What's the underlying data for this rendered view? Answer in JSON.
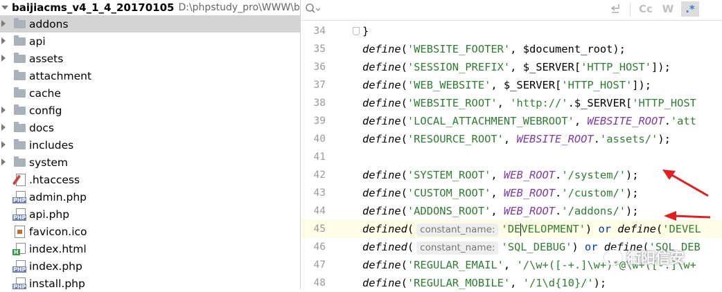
{
  "project": {
    "root_name": "baijiacms_v4_1_4_20170105",
    "root_path": "D:\\phpstudy_pro\\WWW\\ba"
  },
  "tree": [
    {
      "label": "addons",
      "type": "folder",
      "expandable": true,
      "selected": true
    },
    {
      "label": "api",
      "type": "folder",
      "expandable": true
    },
    {
      "label": "assets",
      "type": "folder",
      "expandable": true
    },
    {
      "label": "attachment",
      "type": "folder",
      "expandable": false
    },
    {
      "label": "cache",
      "type": "folder",
      "expandable": false
    },
    {
      "label": "config",
      "type": "folder",
      "expandable": true
    },
    {
      "label": "docs",
      "type": "folder",
      "expandable": true
    },
    {
      "label": "includes",
      "type": "folder",
      "expandable": true
    },
    {
      "label": "system",
      "type": "folder",
      "expandable": true
    },
    {
      "label": ".htaccess",
      "type": "htaccess"
    },
    {
      "label": "admin.php",
      "type": "php"
    },
    {
      "label": "api.php",
      "type": "php"
    },
    {
      "label": "favicon.ico",
      "type": "ico"
    },
    {
      "label": "index.html",
      "type": "html"
    },
    {
      "label": "index.php",
      "type": "php"
    },
    {
      "label": "install.php",
      "type": "php"
    }
  ],
  "icons": {
    "php_tag": "PHP",
    "html_tag": "H"
  },
  "search_bar": {
    "case_toggle": "Cc",
    "word_toggle": "W",
    "regex_toggle": ".*"
  },
  "code_lines": [
    {
      "num": "34",
      "segments": [
        {
          "t": "}",
          "c": ""
        }
      ]
    },
    {
      "num": "35",
      "segments": [
        {
          "t": "define",
          "c": "fn"
        },
        {
          "t": "(",
          "c": ""
        },
        {
          "t": "'WEBSITE_FOOTER'",
          "c": "str"
        },
        {
          "t": ", $document_root);",
          "c": "var"
        }
      ]
    },
    {
      "num": "36",
      "segments": [
        {
          "t": "define",
          "c": "fn"
        },
        {
          "t": "(",
          "c": ""
        },
        {
          "t": "'SESSION_PREFIX'",
          "c": "str"
        },
        {
          "t": ", $_SERVER[",
          "c": "var"
        },
        {
          "t": "'HTTP_HOST'",
          "c": "str"
        },
        {
          "t": "]);",
          "c": ""
        }
      ]
    },
    {
      "num": "37",
      "segments": [
        {
          "t": "define",
          "c": "fn"
        },
        {
          "t": "(",
          "c": ""
        },
        {
          "t": "'WEB_WEBSITE'",
          "c": "str"
        },
        {
          "t": ", $_SERVER[",
          "c": "var"
        },
        {
          "t": "'HTTP_HOST'",
          "c": "str"
        },
        {
          "t": "]);",
          "c": ""
        }
      ]
    },
    {
      "num": "38",
      "segments": [
        {
          "t": "define",
          "c": "fn"
        },
        {
          "t": "(",
          "c": ""
        },
        {
          "t": "'WEBSITE_ROOT'",
          "c": "str"
        },
        {
          "t": ", ",
          "c": ""
        },
        {
          "t": "'http://'",
          "c": "str"
        },
        {
          "t": ".$_SERVER[",
          "c": "var"
        },
        {
          "t": "'HTTP_HOST",
          "c": "str"
        }
      ]
    },
    {
      "num": "39",
      "segments": [
        {
          "t": "define",
          "c": "fn"
        },
        {
          "t": "(",
          "c": ""
        },
        {
          "t": "'LOCAL_ATTACHMENT_WEBROOT'",
          "c": "str"
        },
        {
          "t": ", ",
          "c": ""
        },
        {
          "t": "WEBSITE_ROOT",
          "c": "const"
        },
        {
          "t": ".",
          "c": ""
        },
        {
          "t": "'att",
          "c": "str"
        }
      ]
    },
    {
      "num": "40",
      "segments": [
        {
          "t": "define",
          "c": "fn"
        },
        {
          "t": "(",
          "c": ""
        },
        {
          "t": "'RESOURCE_ROOT'",
          "c": "str"
        },
        {
          "t": ", ",
          "c": ""
        },
        {
          "t": "WEBSITE_ROOT",
          "c": "const"
        },
        {
          "t": ".",
          "c": ""
        },
        {
          "t": "'assets/'",
          "c": "str"
        },
        {
          "t": ");",
          "c": ""
        }
      ]
    },
    {
      "num": "41",
      "segments": []
    },
    {
      "num": "42",
      "segments": [
        {
          "t": "define",
          "c": "fn"
        },
        {
          "t": "(",
          "c": ""
        },
        {
          "t": "'SYSTEM_ROOT'",
          "c": "str"
        },
        {
          "t": ", ",
          "c": ""
        },
        {
          "t": "WEB_ROOT",
          "c": "const"
        },
        {
          "t": ".",
          "c": ""
        },
        {
          "t": "'/system/'",
          "c": "str"
        },
        {
          "t": ");",
          "c": ""
        }
      ]
    },
    {
      "num": "43",
      "segments": [
        {
          "t": "define",
          "c": "fn"
        },
        {
          "t": "(",
          "c": ""
        },
        {
          "t": "'CUSTOM_ROOT'",
          "c": "str"
        },
        {
          "t": ", ",
          "c": ""
        },
        {
          "t": "WEB_ROOT",
          "c": "const"
        },
        {
          "t": ".",
          "c": ""
        },
        {
          "t": "'/custom/'",
          "c": "str"
        },
        {
          "t": ");",
          "c": ""
        }
      ]
    },
    {
      "num": "44",
      "segments": [
        {
          "t": "define",
          "c": "fn"
        },
        {
          "t": "(",
          "c": ""
        },
        {
          "t": "'ADDONS_ROOT'",
          "c": "str"
        },
        {
          "t": ", ",
          "c": ""
        },
        {
          "t": "WEB_ROOT",
          "c": "const"
        },
        {
          "t": ".",
          "c": ""
        },
        {
          "t": "'/addons/'",
          "c": "str"
        },
        {
          "t": ");",
          "c": ""
        }
      ]
    },
    {
      "num": "45",
      "current": true,
      "segments": [
        {
          "t": "defined",
          "c": "fn"
        },
        {
          "t": "(",
          "c": ""
        },
        {
          "t": "constant_name:",
          "c": "hint"
        },
        {
          "t": "'DE",
          "c": "str"
        },
        {
          "t": "",
          "c": "caret"
        },
        {
          "t": "VELOPMENT'",
          "c": "str"
        },
        {
          "t": ") ",
          "c": ""
        },
        {
          "t": "or",
          "c": "kw"
        },
        {
          "t": " ",
          "c": ""
        },
        {
          "t": "define",
          "c": "fn"
        },
        {
          "t": "(",
          "c": ""
        },
        {
          "t": "'DEVEL",
          "c": "str"
        }
      ]
    },
    {
      "num": "46",
      "segments": [
        {
          "t": "defined",
          "c": "fn"
        },
        {
          "t": "(",
          "c": ""
        },
        {
          "t": "constant_name:",
          "c": "hint"
        },
        {
          "t": "'SQL_DEBUG'",
          "c": "str"
        },
        {
          "t": ") ",
          "c": ""
        },
        {
          "t": "or",
          "c": "kw"
        },
        {
          "t": " ",
          "c": ""
        },
        {
          "t": "define",
          "c": "fn"
        },
        {
          "t": "(",
          "c": ""
        },
        {
          "t": "'SQL_DEB",
          "c": "str"
        }
      ]
    },
    {
      "num": "47",
      "segments": [
        {
          "t": "define",
          "c": "fn"
        },
        {
          "t": "(",
          "c": ""
        },
        {
          "t": "'REGULAR_EMAIL'",
          "c": "str"
        },
        {
          "t": ", ",
          "c": ""
        },
        {
          "t": "'/\\w+([-+.]\\w+)*@\\w+([-.]\\w+",
          "c": "str"
        }
      ]
    },
    {
      "num": "48",
      "segments": [
        {
          "t": "define",
          "c": "fn"
        },
        {
          "t": "(",
          "c": ""
        },
        {
          "t": "'REGULAR_MOBILE'",
          "c": "str"
        },
        {
          "t": ", ",
          "c": ""
        },
        {
          "t": "'/1\\d{10}/'",
          "c": "str"
        },
        {
          "t": ");",
          "c": ""
        }
      ]
    }
  ],
  "watermark": "衢阳信安",
  "colors": {
    "selection": "#d4d4d4",
    "string": "#2e7d32",
    "constant": "#7a3aa8",
    "keyword": "#0033b3",
    "annotation_arrow": "#e02020"
  }
}
